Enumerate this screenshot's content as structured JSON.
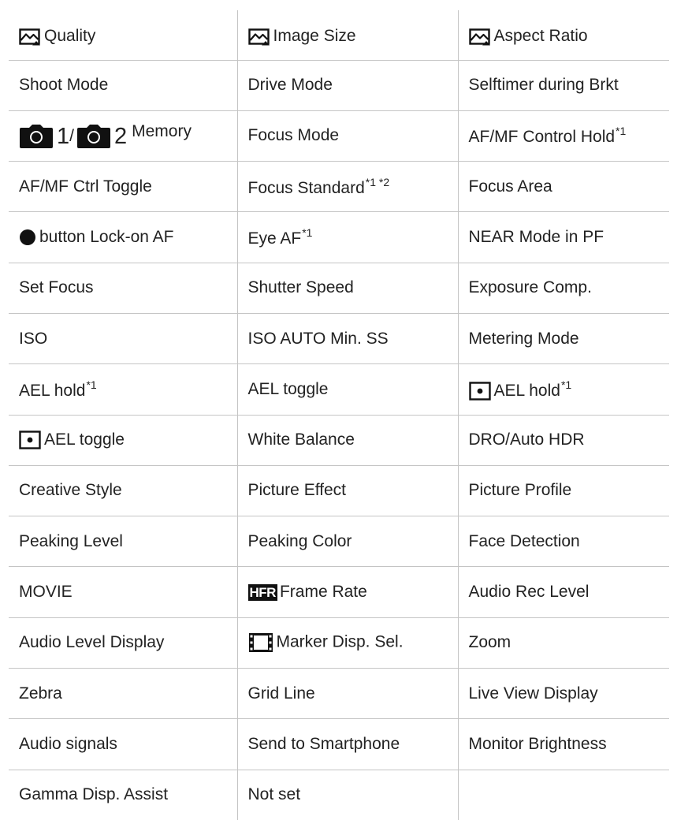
{
  "rows": [
    [
      {
        "icon": "picture-quality-icon",
        "text": "Quality"
      },
      {
        "icon": "picture-quality-icon",
        "text": "Image Size"
      },
      {
        "icon": "picture-quality-icon",
        "text": "Aspect Ratio"
      }
    ],
    [
      {
        "text": "Shoot Mode"
      },
      {
        "text": "Drive Mode"
      },
      {
        "text": "Selftimer during Brkt"
      }
    ],
    [
      {
        "special": "memory",
        "num1": "1",
        "slash": "/",
        "num2": "2",
        "text": "Memory"
      },
      {
        "text": "Focus Mode"
      },
      {
        "text": "AF/MF Control Hold",
        "sup": "*1"
      }
    ],
    [
      {
        "text": "AF/MF Ctrl Toggle"
      },
      {
        "text": "Focus Standard",
        "sup": "*1 *2"
      },
      {
        "text": "Focus Area"
      }
    ],
    [
      {
        "icon": "center-button-icon",
        "text": "button Lock-on AF"
      },
      {
        "text": "Eye AF",
        "sup": "*1"
      },
      {
        "text": "NEAR Mode in PF"
      }
    ],
    [
      {
        "text": "Set Focus"
      },
      {
        "text": "Shutter Speed"
      },
      {
        "text": "Exposure Comp."
      }
    ],
    [
      {
        "text": "ISO"
      },
      {
        "text": "ISO AUTO Min. SS"
      },
      {
        "text": "Metering Mode"
      }
    ],
    [
      {
        "text": "AEL hold",
        "sup": "*1"
      },
      {
        "text": "AEL toggle"
      },
      {
        "icon": "spot-metering-icon",
        "text": "AEL hold",
        "sup": "*1"
      }
    ],
    [
      {
        "icon": "spot-metering-icon",
        "text": "AEL toggle"
      },
      {
        "text": "White Balance"
      },
      {
        "text": "DRO/Auto HDR"
      }
    ],
    [
      {
        "text": "Creative Style"
      },
      {
        "text": "Picture Effect"
      },
      {
        "text": "Picture Profile"
      }
    ],
    [
      {
        "text": "Peaking Level"
      },
      {
        "text": "Peaking Color"
      },
      {
        "text": "Face Detection"
      }
    ],
    [
      {
        "text": "MOVIE"
      },
      {
        "icon": "hfr-icon",
        "badge": "HFR",
        "text": "Frame Rate"
      },
      {
        "text": "Audio Rec Level"
      }
    ],
    [
      {
        "text": "Audio Level Display"
      },
      {
        "icon": "film-strip-icon",
        "text": "Marker Disp. Sel."
      },
      {
        "text": "Zoom"
      }
    ],
    [
      {
        "text": "Zebra"
      },
      {
        "text": "Grid Line"
      },
      {
        "text": "Live View Display"
      }
    ],
    [
      {
        "text": "Audio signals"
      },
      {
        "text": "Send to Smartphone"
      },
      {
        "text": "Monitor Brightness"
      }
    ],
    [
      {
        "text": "Gamma Disp. Assist"
      },
      {
        "text": "Not set"
      },
      {
        "text": ""
      }
    ]
  ]
}
